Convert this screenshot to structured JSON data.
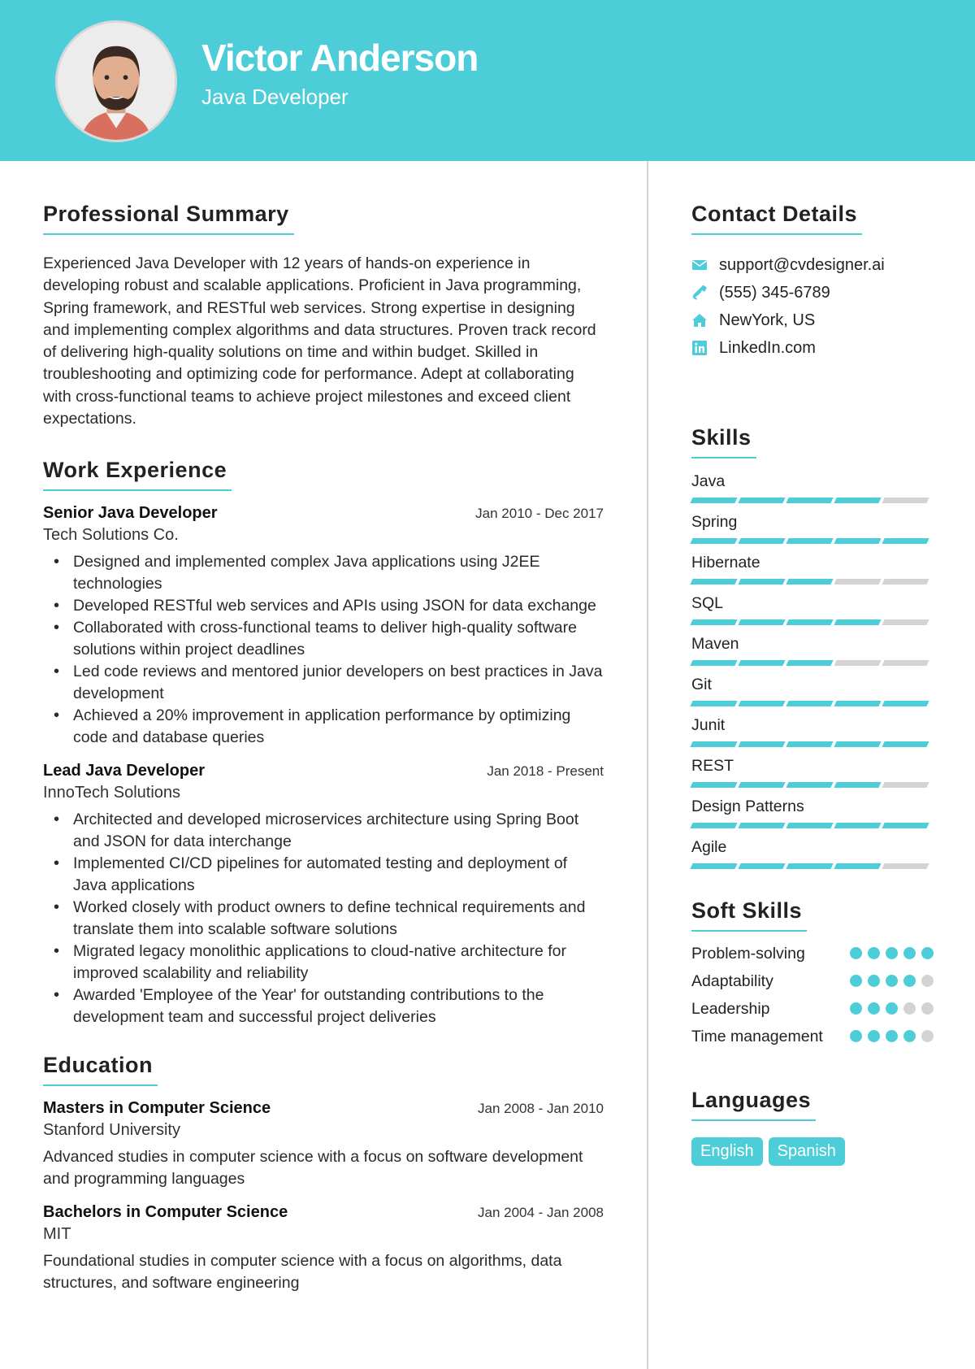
{
  "header": {
    "name": "Victor Anderson",
    "title": "Java Developer"
  },
  "colors": {
    "accent": "#4ccdd7",
    "inactive": "#d3d3d3"
  },
  "summary": {
    "heading": "Professional Summary",
    "text": "Experienced Java Developer with 12 years of hands-on experience in developing robust and scalable applications. Proficient in Java programming, Spring framework, and RESTful web services. Strong expertise in designing and implementing complex algorithms and data structures. Proven track record of delivering high-quality solutions on time and within budget. Skilled in troubleshooting and optimizing code for performance. Adept at collaborating with cross-functional teams to achieve project milestones and exceed client expectations."
  },
  "experience": {
    "heading": "Work Experience",
    "jobs": [
      {
        "title": "Senior Java Developer",
        "date": "Jan 2010 - Dec 2017",
        "company": "Tech Solutions Co.",
        "bullets": [
          "Designed and implemented complex Java applications using J2EE technologies",
          "Developed RESTful web services and APIs using JSON for data exchange",
          "Collaborated with cross-functional teams to deliver high-quality software solutions within project deadlines",
          "Led code reviews and mentored junior developers on best practices in Java development",
          "Achieved a 20% improvement in application performance by optimizing code and database queries"
        ]
      },
      {
        "title": "Lead Java Developer",
        "date": "Jan 2018 - Present",
        "company": "InnoTech Solutions",
        "bullets": [
          "Architected and developed microservices architecture using Spring Boot and JSON for data interchange",
          "Implemented CI/CD pipelines for automated testing and deployment of Java applications",
          "Worked closely with product owners to define technical requirements and translate them into scalable software solutions",
          "Migrated legacy monolithic applications to cloud-native architecture for improved scalability and reliability",
          "Awarded 'Employee of the Year' for outstanding contributions to the development team and successful project deliveries"
        ]
      }
    ]
  },
  "education": {
    "heading": "Education",
    "items": [
      {
        "degree": "Masters in Computer Science",
        "date": "Jan 2008 - Jan 2010",
        "school": "Stanford University",
        "description": "Advanced studies in computer science with a focus on software development and programming languages"
      },
      {
        "degree": "Bachelors in Computer Science",
        "date": "Jan 2004 - Jan 2008",
        "school": "MIT",
        "description": "Foundational studies in computer science with a focus on algorithms, data structures, and software engineering"
      }
    ]
  },
  "contact": {
    "heading": "Contact Details",
    "items": [
      {
        "icon": "envelope-icon",
        "text": "support@cvdesigner.ai"
      },
      {
        "icon": "phone-icon",
        "text": "(555) 345-6789"
      },
      {
        "icon": "home-icon",
        "text": "NewYork, US"
      },
      {
        "icon": "linkedin-icon",
        "text": "LinkedIn.com"
      }
    ]
  },
  "skills": {
    "heading": "Skills",
    "max": 5,
    "items": [
      {
        "name": "Java",
        "level": 4
      },
      {
        "name": "Spring",
        "level": 5
      },
      {
        "name": "Hibernate",
        "level": 3
      },
      {
        "name": "SQL",
        "level": 4
      },
      {
        "name": "Maven",
        "level": 3
      },
      {
        "name": "Git",
        "level": 5
      },
      {
        "name": "Junit",
        "level": 5
      },
      {
        "name": "REST",
        "level": 4
      },
      {
        "name": "Design Patterns",
        "level": 5
      },
      {
        "name": "Agile",
        "level": 4
      }
    ]
  },
  "soft_skills": {
    "heading": "Soft Skills",
    "max": 5,
    "items": [
      {
        "name": "Problem-solving",
        "level": 5
      },
      {
        "name": "Adaptability",
        "level": 4
      },
      {
        "name": "Leadership",
        "level": 3
      },
      {
        "name": "Time management",
        "level": 4
      }
    ]
  },
  "languages": {
    "heading": "Languages",
    "items": [
      "English",
      "Spanish"
    ]
  }
}
